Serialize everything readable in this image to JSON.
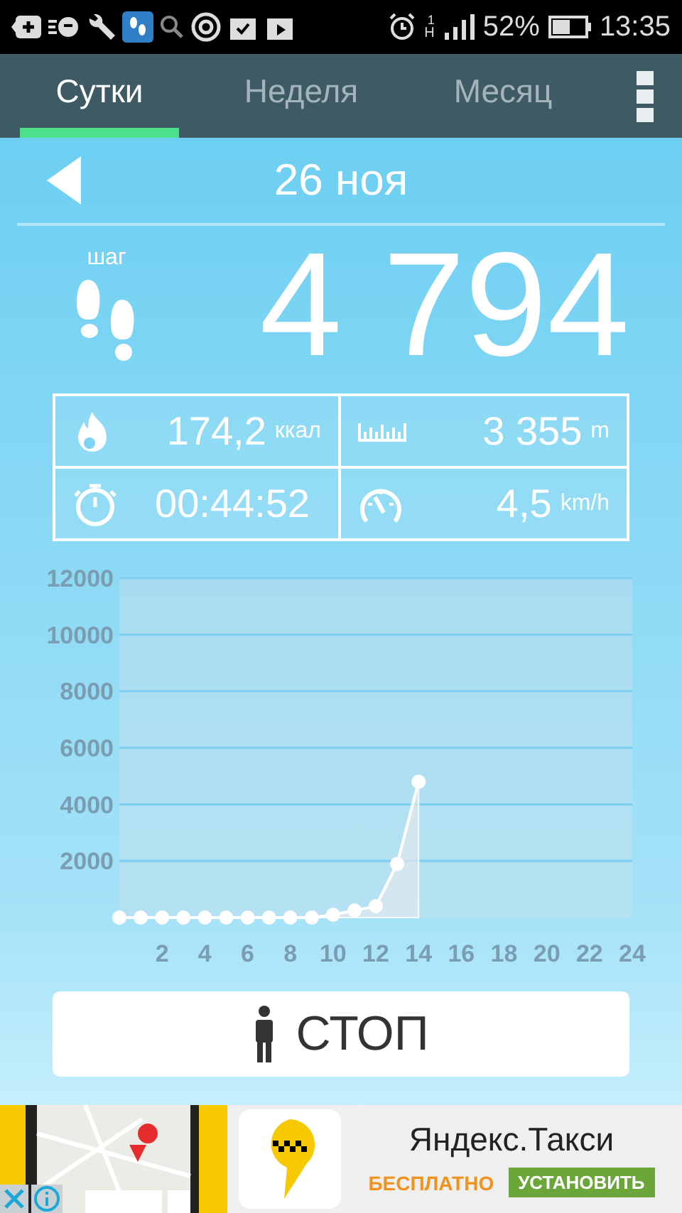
{
  "status_bar": {
    "network": "H",
    "sim": "1",
    "battery": "52%",
    "time": "13:35"
  },
  "tabs": [
    {
      "label": "Сутки",
      "selected": true
    },
    {
      "label": "Неделя",
      "selected": false
    },
    {
      "label": "Месяц",
      "selected": false
    }
  ],
  "date": "26 ноя",
  "steps": {
    "label": "шаг",
    "value": "4 794"
  },
  "stats": [
    {
      "kind": "fire",
      "value": "174,2",
      "unit": "ккал"
    },
    {
      "kind": "ruler",
      "value": "3 355",
      "unit": "m"
    },
    {
      "kind": "stopwatch",
      "value": "00:44:52"
    },
    {
      "kind": "speedometer",
      "value": "4,5",
      "unit": "km/h"
    }
  ],
  "chart_data": {
    "type": "area",
    "x": [
      0,
      1,
      2,
      3,
      4,
      5,
      6,
      7,
      8,
      9,
      10,
      11,
      12,
      13,
      14
    ],
    "series": [
      {
        "color": "#ffffff",
        "values": [
          0,
          0,
          0,
          0,
          0,
          0,
          0,
          0,
          0,
          0,
          100,
          250,
          400,
          1900,
          4800
        ]
      }
    ],
    "grid": true,
    "xlim": [
      0,
      24
    ],
    "ylim": [
      0,
      12000
    ],
    "xticks": [
      2,
      4,
      6,
      8,
      10,
      12,
      14,
      16,
      18,
      20,
      22,
      24
    ],
    "yticks": [
      2000,
      4000,
      6000,
      8000,
      10000,
      12000
    ]
  },
  "stop_button": {
    "label": "СТОП"
  },
  "ad": {
    "kind": "picture",
    "title": "Яндекс.Такси",
    "price": "БЕСПЛАТНО",
    "install": "УСТАНОВИТЬ"
  }
}
